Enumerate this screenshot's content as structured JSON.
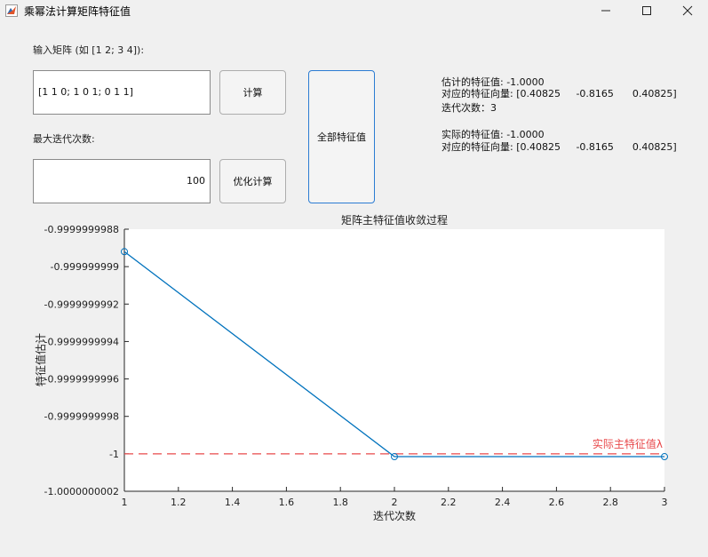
{
  "window": {
    "title": "乘幂法计算矩阵特征值",
    "icon": "matlab-icon",
    "controls": [
      "minimize-icon",
      "maximize-icon",
      "close-icon"
    ]
  },
  "form": {
    "matrix_label": "输入矩阵 (如 [1 2; 3 4]):",
    "matrix_value": "[1 1 0;      1 0 1;      0 1 1]",
    "iter_label": "最大迭代次数:",
    "iter_value": "100",
    "compute_label": "计算",
    "optimize_label": "优化计算",
    "all_eigen_label": "全部特征值"
  },
  "results": {
    "estimated_value": "估计的特征值: -1.0000",
    "estimated_vector": "对应的特征向量: [0.40825     -0.8165      0.40825]",
    "iterations": "迭代次数：3",
    "actual_value": "实际的特征值: -1.0000",
    "actual_vector": "对应的特征向量: [0.40825     -0.8165      0.40825]"
  },
  "chart_data": {
    "type": "line",
    "title": "矩阵主特征值收敛过程",
    "xlabel": "迭代次数",
    "ylabel": "特征值估计",
    "xlim": [
      1,
      3
    ],
    "ylim": [
      -1.0000000002,
      -0.9999999988
    ],
    "x_ticks": [
      "1",
      "1.2",
      "1.4",
      "1.6",
      "1.8",
      "2",
      "2.2",
      "2.4",
      "2.6",
      "2.8",
      "3"
    ],
    "y_ticks": [
      "-0.9999999988",
      "-0.999999999",
      "-0.9999999992",
      "-0.9999999994",
      "-0.9999999996",
      "-0.9999999998",
      "-1",
      "-1.0000000002"
    ],
    "series": [
      {
        "x": [
          1,
          2,
          3
        ],
        "y": [
          -0.99999999892,
          -1.000000000015,
          -1.000000000015
        ],
        "color": "#0072bd",
        "marker": "circle"
      }
    ],
    "reference_line": {
      "y": -1.0,
      "label": "实际主特征值λ",
      "color": "#e8494b",
      "style": "dashed"
    },
    "grid": false
  }
}
